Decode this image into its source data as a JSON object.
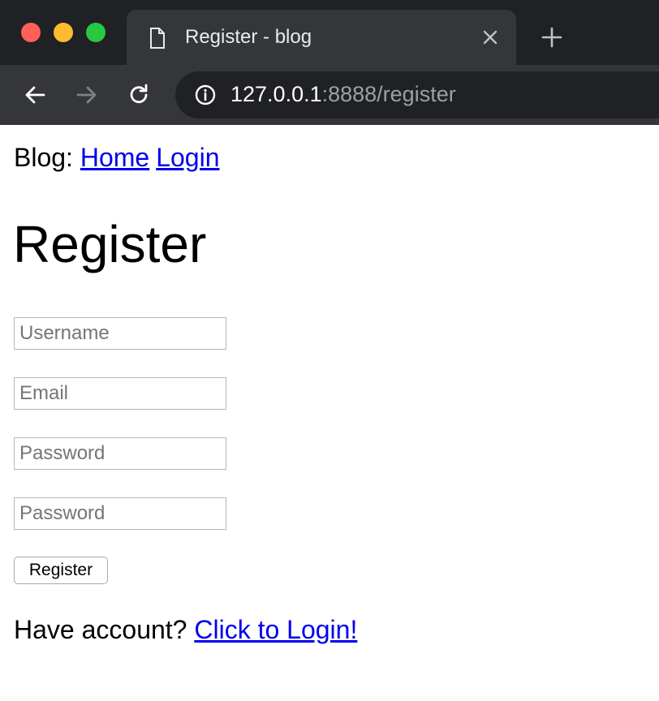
{
  "browser": {
    "tab_title": "Register - blog",
    "url_host": "127.0.0.1",
    "url_rest": ":8888/register",
    "icons": {
      "tab": "page-icon",
      "close": "close-icon",
      "new_tab": "plus-icon",
      "back": "back-arrow-icon",
      "forward": "forward-arrow-icon",
      "reload": "reload-icon",
      "site_info": "info-icon"
    }
  },
  "nav": {
    "prefix": "Blog:",
    "home": "Home",
    "login": "Login"
  },
  "heading": "Register",
  "form": {
    "username_placeholder": "Username",
    "email_placeholder": "Email",
    "password_placeholder": "Password",
    "password_confirm_placeholder": "Password",
    "submit_label": "Register"
  },
  "footer": {
    "text": "Have account?",
    "link": "Click to Login!"
  },
  "colors": {
    "link": "#0000ee",
    "chrome_dark": "#202124",
    "chrome_tab": "#35363a"
  }
}
